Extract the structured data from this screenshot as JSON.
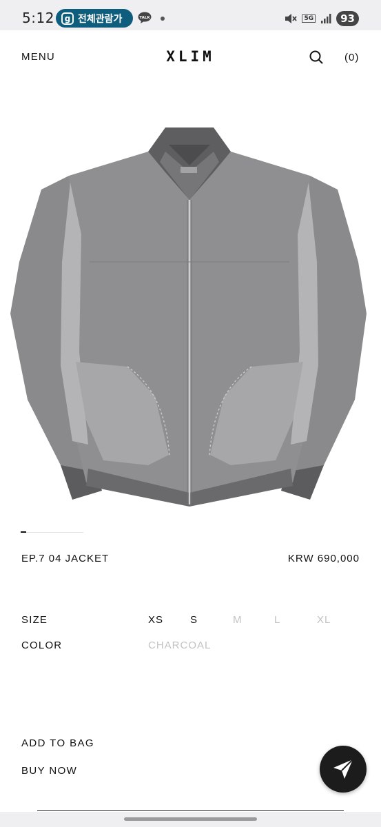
{
  "status_bar": {
    "time": "5:12",
    "pill_icon_letter": "g",
    "pill_text": "전체관람가",
    "talk_label": "TALK",
    "network": "5G",
    "battery": "93"
  },
  "header": {
    "menu_label": "MENU",
    "logo": "XLIM",
    "cart_label": "(0)"
  },
  "product": {
    "image_alt": "jacket-photo",
    "name": "EP.7 04 JACKET",
    "price": "KRW 690,000",
    "gallery": {
      "current": 1
    }
  },
  "options": {
    "size_label": "SIZE",
    "sizes": [
      {
        "label": "XS",
        "available": true
      },
      {
        "label": "S",
        "available": true
      },
      {
        "label": "M",
        "available": false
      },
      {
        "label": "L",
        "available": false
      },
      {
        "label": "XL",
        "available": false
      }
    ],
    "color_label": "COLOR",
    "color_value": "CHARCOAL"
  },
  "actions": {
    "add_to_bag": "ADD TO BAG",
    "buy_now": "BUY NOW"
  },
  "colors": {
    "accent_pill": "#0f5d7c",
    "text": "#111111",
    "disabled": "#c2c2c2",
    "fab": "#1c1c1c"
  }
}
